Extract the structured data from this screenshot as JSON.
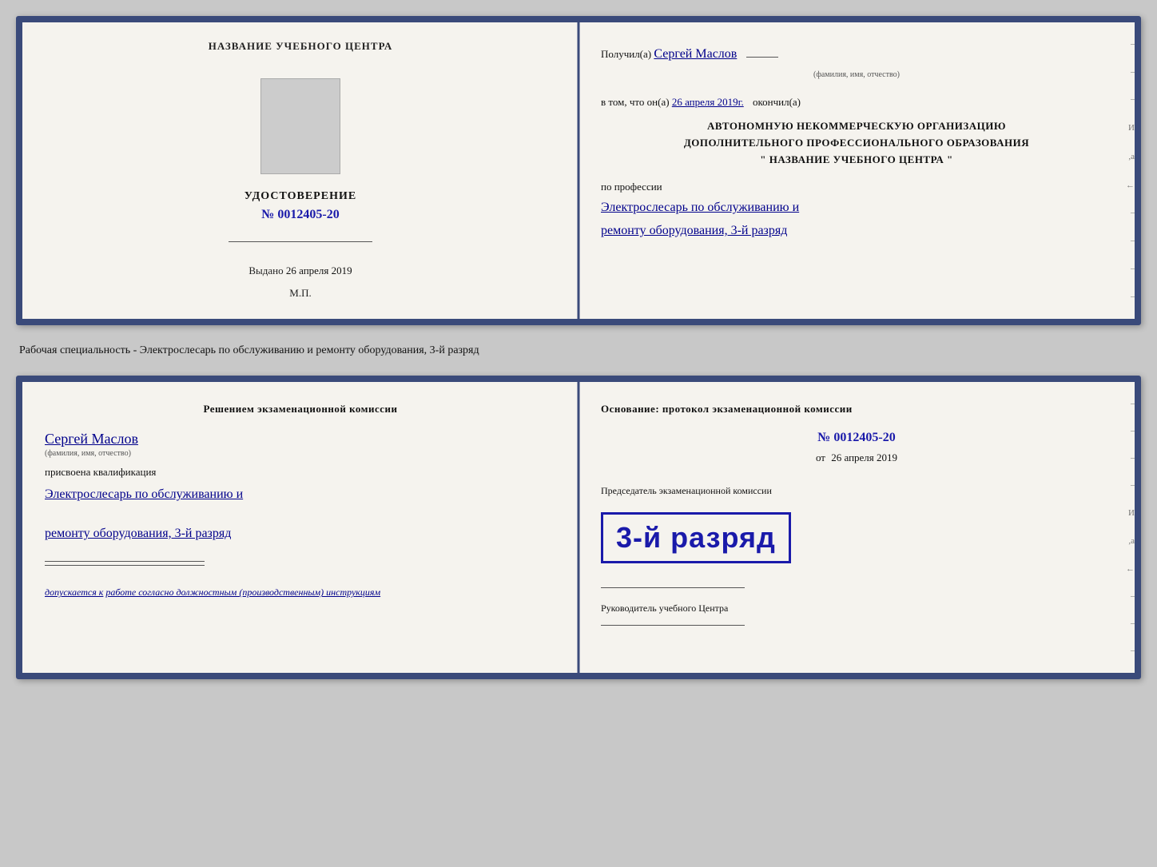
{
  "top_cert": {
    "left": {
      "school_name": "НАЗВАНИЕ УЧЕБНОГО ЦЕНТРА",
      "udostoverenie_title": "УДОСТОВЕРЕНИЕ",
      "cert_number": "№ 0012405-20",
      "issued_label": "Выдано",
      "issued_date": "26 апреля 2019",
      "mp_label": "М.П."
    },
    "right": {
      "received_label": "Получил(а)",
      "received_name": "Сергей Маслов",
      "fio_label": "(фамилия, имя, отчество)",
      "in_that_label": "в том, что он(а)",
      "date_value": "26 апреля 2019г.",
      "finished_label": "окончил(а)",
      "org_line1": "АВТОНОМНУЮ НЕКОММЕРЧЕСКУЮ ОРГАНИЗАЦИЮ",
      "org_line2": "ДОПОЛНИТЕЛЬНОГО ПРОФЕССИОНАЛЬНОГО ОБРАЗОВАНИЯ",
      "org_line3": "\" НАЗВАНИЕ УЧЕБНОГО ЦЕНТРА \"",
      "profession_label": "по профессии",
      "profession_value1": "Электрослесарь по обслуживанию и",
      "profession_value2": "ремонту оборудования, 3-й разряд"
    }
  },
  "separator": {
    "text": "Рабочая специальность - Электрослесарь по обслуживанию и ремонту оборудования, 3-й разряд"
  },
  "bottom_cert": {
    "left": {
      "komissia_line1": "Решением экзаменационной комиссии",
      "person_name": "Сергей Маслов",
      "fio_label": "(фамилия, имя, отчество)",
      "prisvoena_label": "присвоена квалификация",
      "qualification1": "Электрослесарь по обслуживанию и",
      "qualification2": "ремонту оборудования, 3-й разряд",
      "допускается_label": "допускается к",
      "допускается_value": "работе согласно должностным (производственным) инструкциям"
    },
    "right": {
      "osnovaniye_label": "Основание: протокол экзаменационной комиссии",
      "protocol_number": "№ 0012405-20",
      "ot_label": "от",
      "ot_date": "26 апреля 2019",
      "stamp_text": "3-й разряд",
      "predsedatel_label": "Председатель экзаменационной комиссии",
      "rukovoditel_label": "Руководитель учебного Центра"
    }
  }
}
